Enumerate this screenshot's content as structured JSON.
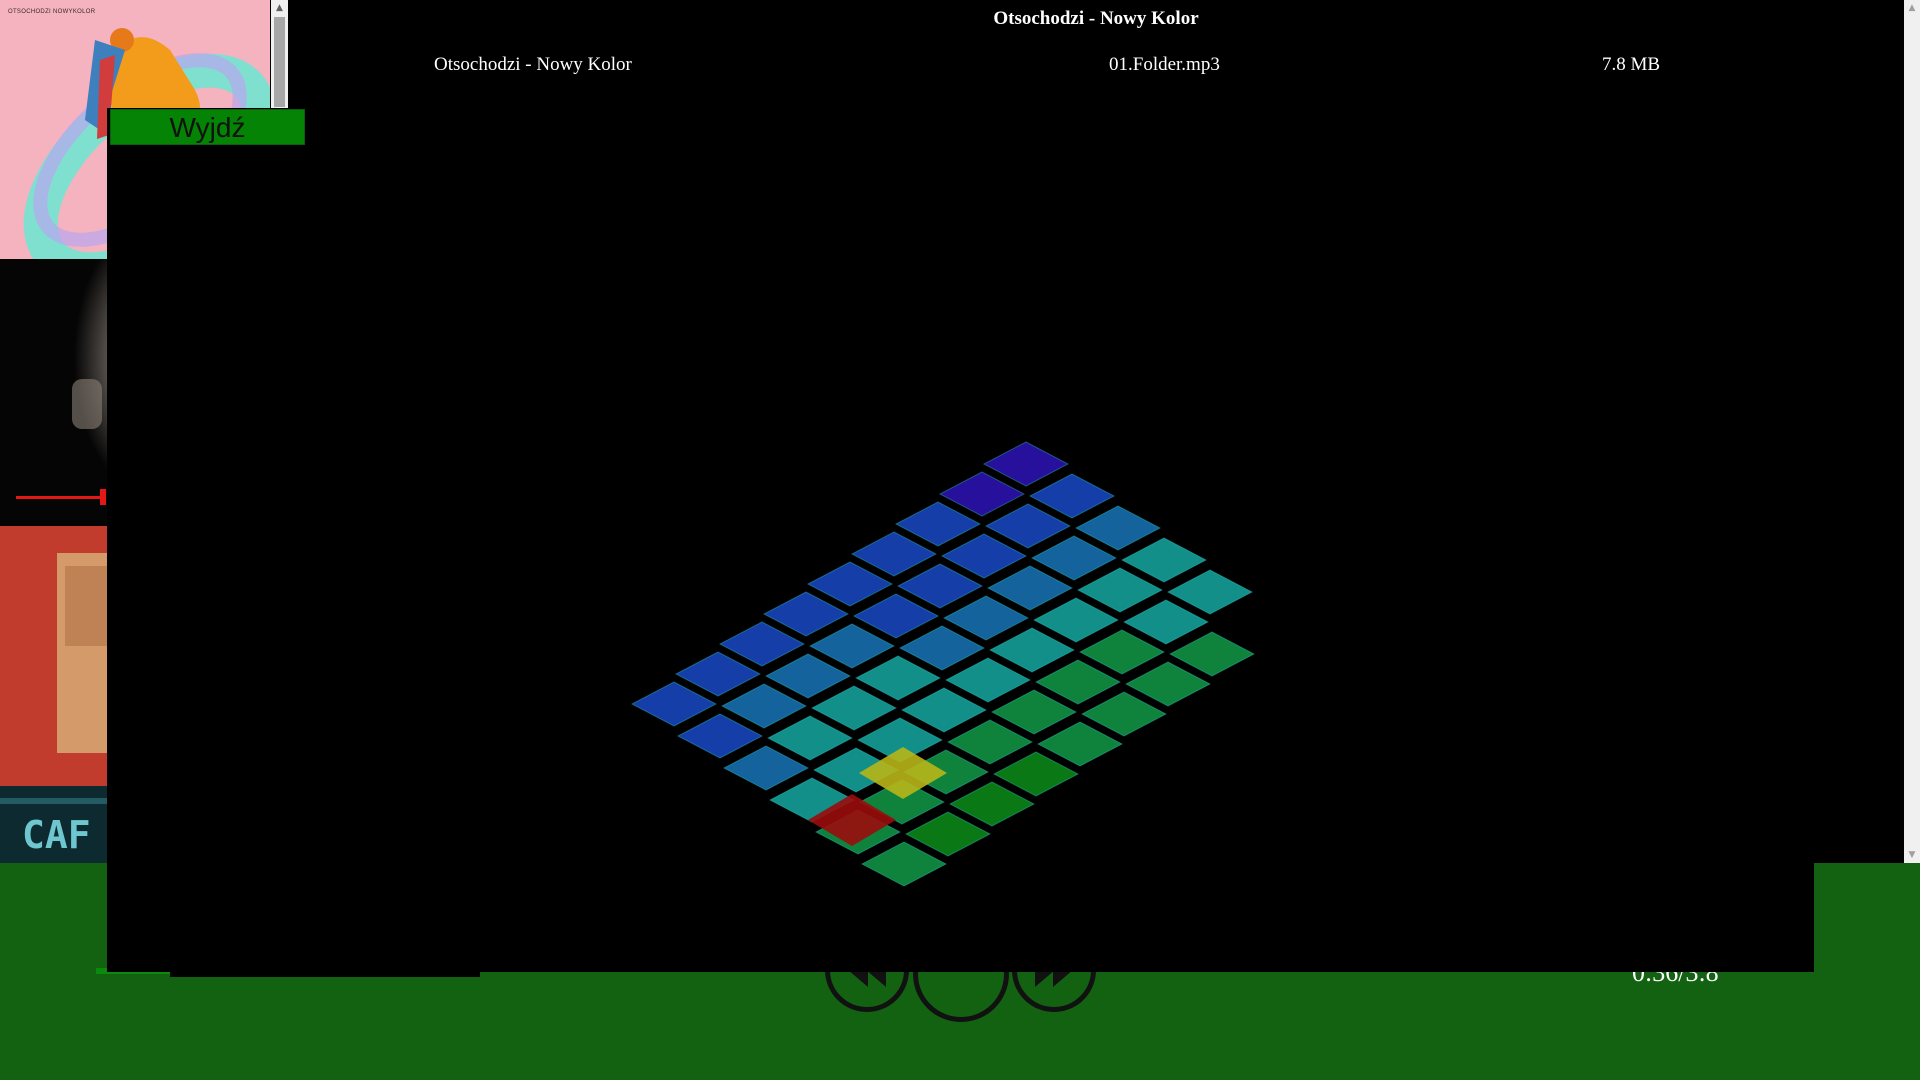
{
  "header": {
    "title": "Otsochodzi - Nowy Kolor"
  },
  "tracks": [
    {
      "name": "Otsochodzi - Nowy Kolor",
      "file": "01.Folder.mp3",
      "size": "7.8 MB"
    }
  ],
  "albums": [
    {
      "caption": "OTSOCHODZI NOWYKOLOR",
      "color": "#f5b2bf"
    },
    {
      "color": "#050505"
    },
    {
      "color": "#c23c2e"
    },
    {
      "color": "#0d2a30"
    }
  ],
  "overlay": {
    "exit_label": "Wyjdź"
  },
  "player": {
    "time": "0:36/3:8",
    "accent": "#126212"
  },
  "add_button": {
    "icon": "plus-circle-icon"
  },
  "visualizer": {
    "rows": [
      [
        0.55,
        0.5,
        0.48,
        0.5,
        0.55,
        0.6,
        0.65,
        0.7
      ],
      [
        0.5,
        0.45,
        0.42,
        0.45,
        0.5,
        0.55,
        0.6,
        0.65,
        0.7
      ],
      [
        0.45,
        0.4,
        0.38,
        0.4,
        0.45,
        0.5,
        0.55,
        0.6,
        0.65
      ],
      [
        0.4,
        0.35,
        0.33,
        0.35,
        0.4,
        0.45,
        0.5,
        0.55,
        0.6
      ],
      [
        0.35,
        0.3,
        0.28,
        0.3,
        0.35,
        0.4,
        0.45,
        0.5,
        0.55
      ],
      [
        0.3,
        0.25,
        0.22,
        0.25,
        0.3,
        0.35,
        0.4,
        0.45,
        0.5
      ]
    ]
  }
}
